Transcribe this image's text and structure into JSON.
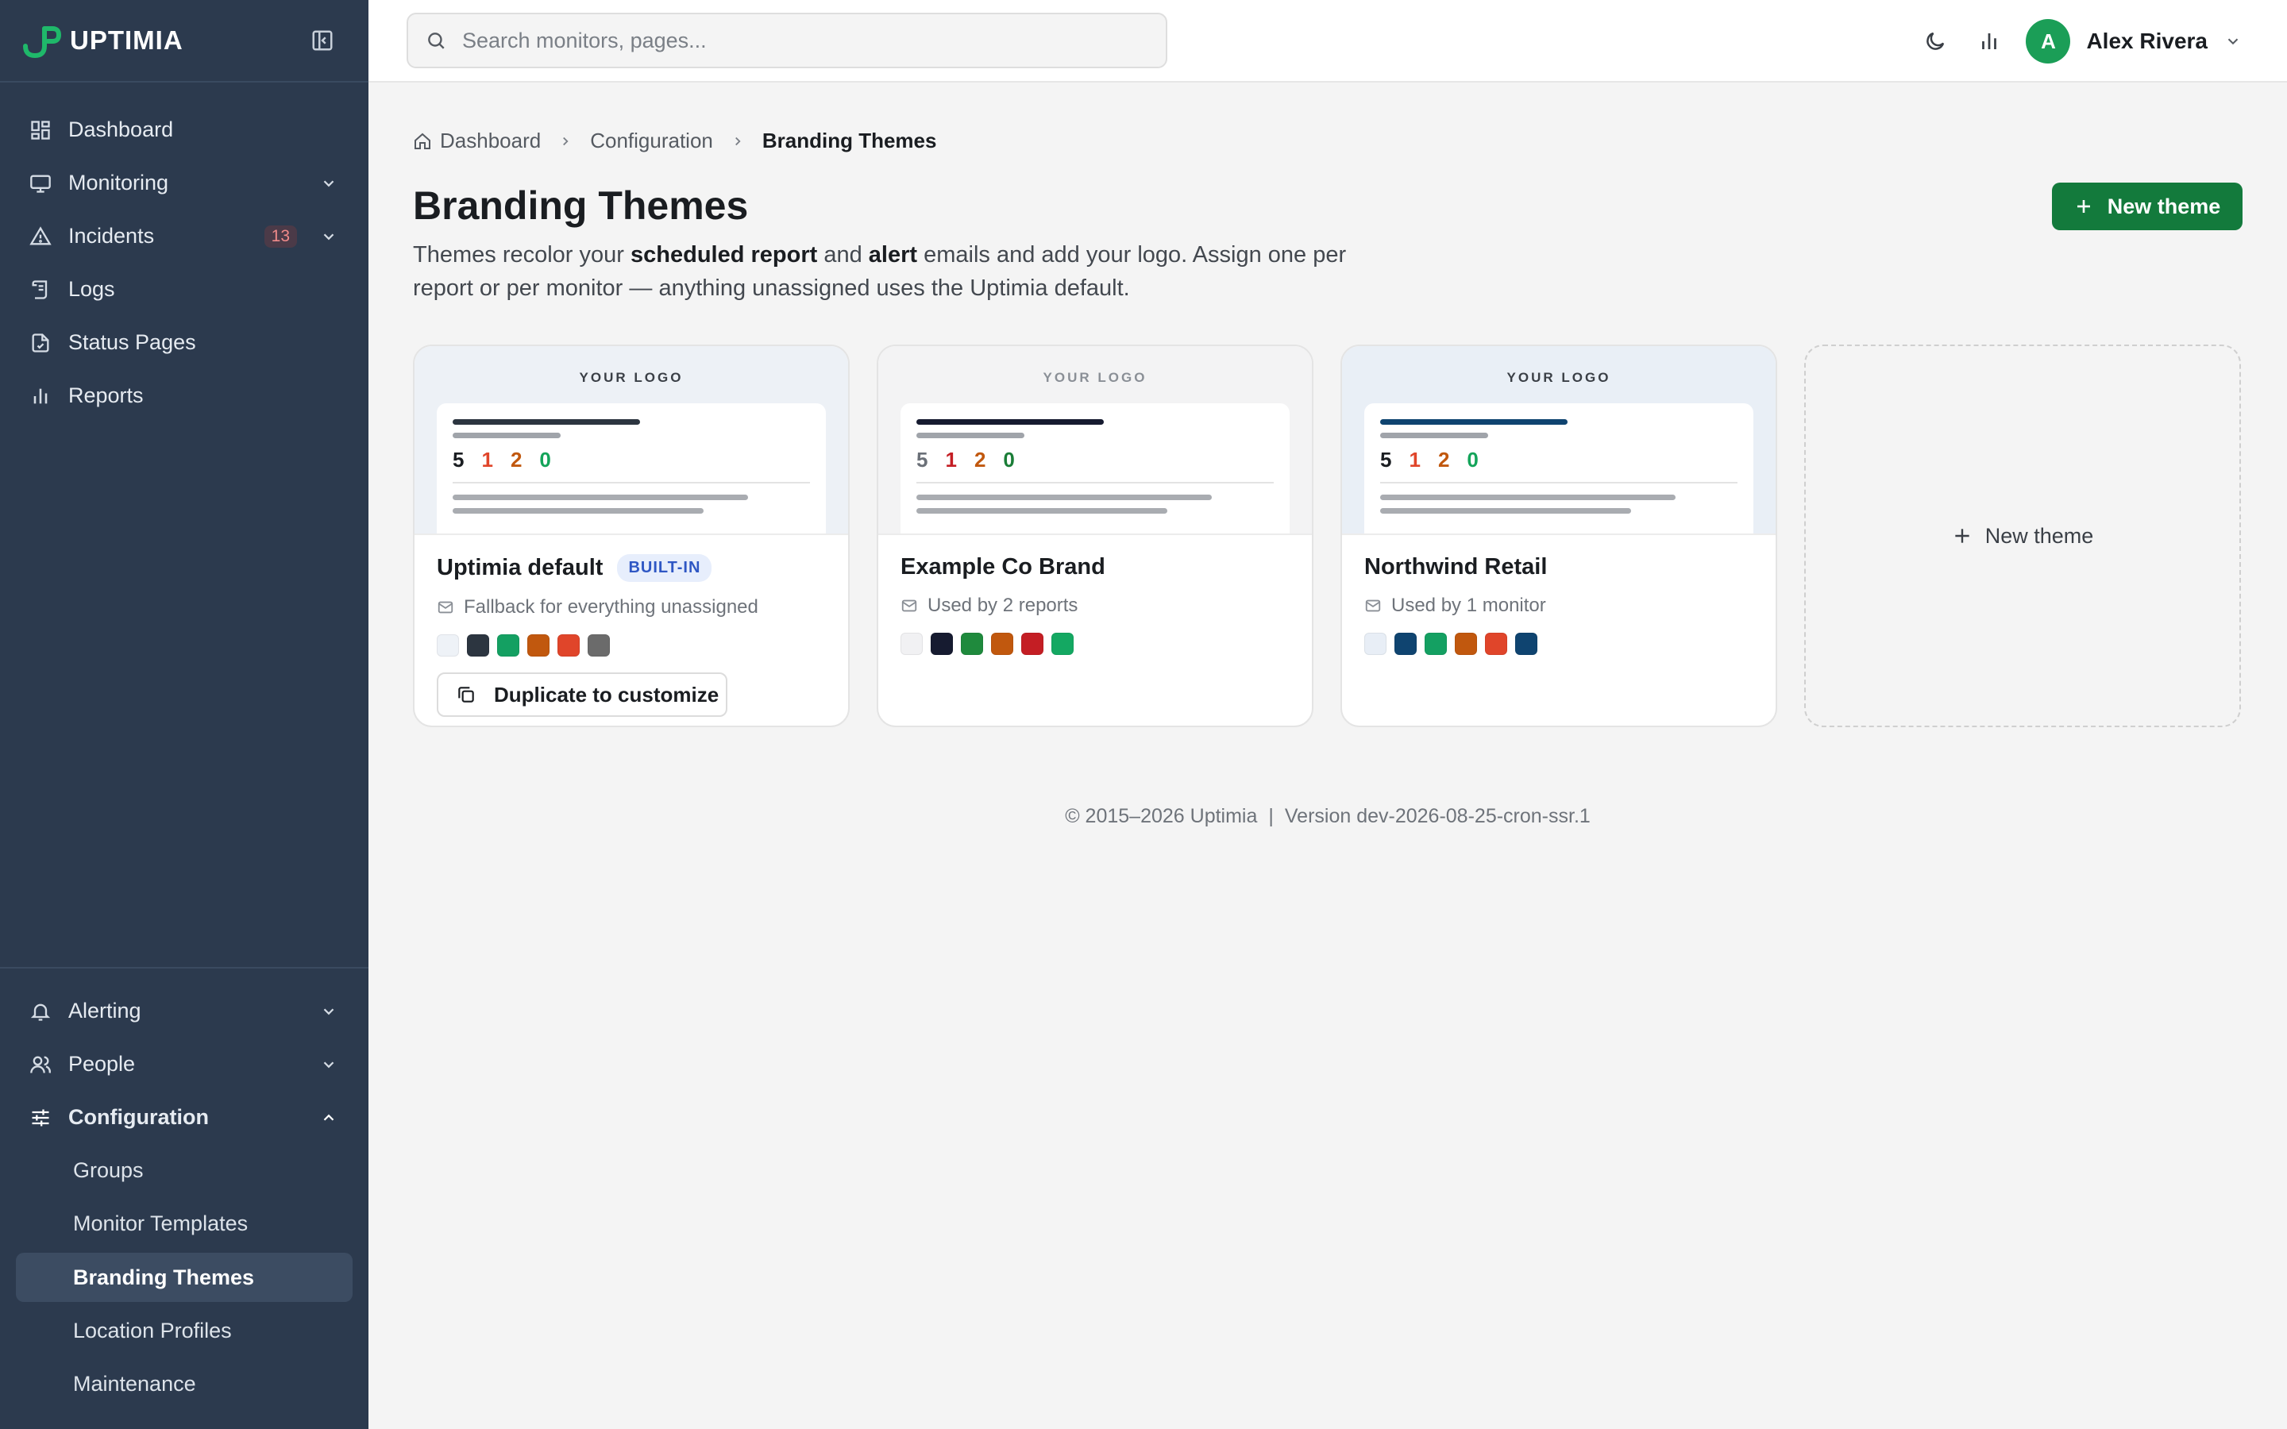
{
  "app": {
    "name": "UPTIMIA"
  },
  "sidebar": {
    "items": [
      {
        "label": "Dashboard",
        "icon": "dashboard-icon"
      },
      {
        "label": "Monitoring",
        "icon": "monitor-icon"
      },
      {
        "label": "Incidents",
        "icon": "warning-triangle-icon",
        "badge": "13"
      },
      {
        "label": "Logs",
        "icon": "scroll-icon"
      },
      {
        "label": "Status Pages",
        "icon": "file-check-icon"
      },
      {
        "label": "Reports",
        "icon": "bar-chart-icon"
      }
    ],
    "bottom_items": [
      {
        "label": "Alerting",
        "icon": "bell-icon"
      },
      {
        "label": "People",
        "icon": "users-icon"
      },
      {
        "label": "Configuration",
        "icon": "sliders-icon"
      }
    ],
    "config_sub": [
      "Groups",
      "Monitor Templates",
      "Branding Themes",
      "Location Profiles",
      "Maintenance"
    ]
  },
  "topbar": {
    "search_placeholder": "Search monitors, pages...",
    "user_initial": "A",
    "user_name": "Alex Rivera"
  },
  "breadcrumb": [
    "Dashboard",
    "Configuration",
    "Branding Themes"
  ],
  "page": {
    "title": "Branding Themes",
    "desc_parts": [
      "Themes recolor your ",
      "scheduled report",
      " and ",
      "alert",
      " emails and add your logo. Assign one per report or per monitor — anything unassigned uses the Uptimia default."
    ],
    "new_theme_label": "New theme"
  },
  "themes": [
    {
      "name": "Uptimia default",
      "badge": "BUILT-IN",
      "usage": "Fallback for everything unassigned",
      "logo_label": "YOUR LOGO",
      "preview_bg": "#edf1f6",
      "accent_bar": "#2c3540",
      "nums": [
        "5",
        "1",
        "2",
        "0"
      ],
      "num_colors": [
        "#1a1d21",
        "#e0452a",
        "#c1580e",
        "#14a45a"
      ],
      "swatches": [
        "#eef2f7",
        "#2c3540",
        "#14a062",
        "#c1580e",
        "#e0452a",
        "#6b6b6b"
      ],
      "action_label": "Duplicate to customize"
    },
    {
      "name": "Example Co Brand",
      "usage": "Used by 2 reports",
      "logo_label": "YOUR LOGO",
      "preview_bg": "#f3f3f4",
      "accent_bar": "#161b30",
      "nums": [
        "5",
        "1",
        "2",
        "0"
      ],
      "num_colors": [
        "#6b7078",
        "#c41e24",
        "#c1580e",
        "#1a7d37"
      ],
      "swatches": [
        "#f1f1f3",
        "#161b30",
        "#1f8a3d",
        "#c1580e",
        "#c41e24",
        "#14a862"
      ]
    },
    {
      "name": "Northwind Retail",
      "usage": "Used by 1 monitor",
      "logo_label": "YOUR LOGO",
      "preview_bg": "#e9eff6",
      "accent_bar": "#0f4470",
      "nums": [
        "5",
        "1",
        "2",
        "0"
      ],
      "num_colors": [
        "#1a1d21",
        "#e0452a",
        "#c1580e",
        "#14a45a"
      ],
      "swatches": [
        "#e8eef6",
        "#0f4470",
        "#14a062",
        "#c1580e",
        "#e0452a",
        "#0f4470"
      ]
    }
  ],
  "new_card_label": "New theme",
  "footer": {
    "copyright": "© 2015–2026 Uptimia",
    "version": "Version dev-2026-08-25-cron-ssr.1"
  },
  "colors": {
    "sidebar_bg": "#2c3a4e",
    "brand_green": "#137a3c",
    "page_bg": "#f4f4f4"
  }
}
